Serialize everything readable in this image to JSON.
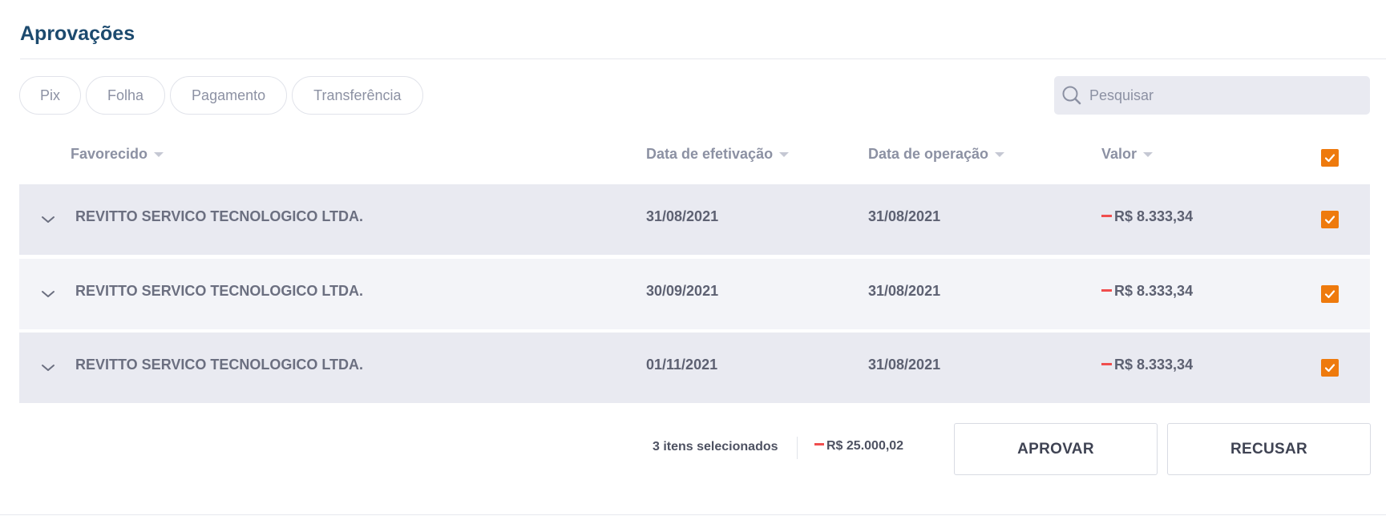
{
  "page": {
    "title": "Aprovações"
  },
  "filters": [
    "Pix",
    "Folha",
    "Pagamento",
    "Transferência"
  ],
  "search": {
    "placeholder": "Pesquisar",
    "value": ""
  },
  "table": {
    "columns": {
      "favorecido": "Favorecido",
      "data_efetivacao": "Data de efetivação",
      "data_operacao": "Data de operação",
      "valor": "Valor"
    },
    "select_all": true,
    "rows": [
      {
        "favorecido": "REVITTO SERVICO TECNOLOGICO LTDA.",
        "data_efetivacao": "31/08/2021",
        "data_operacao": "31/08/2021",
        "valor": "R$ 8.333,34",
        "negative": true,
        "checked": true
      },
      {
        "favorecido": "REVITTO SERVICO TECNOLOGICO LTDA.",
        "data_efetivacao": "30/09/2021",
        "data_operacao": "31/08/2021",
        "valor": "R$ 8.333,34",
        "negative": true,
        "checked": true
      },
      {
        "favorecido": "REVITTO SERVICO TECNOLOGICO LTDA.",
        "data_efetivacao": "01/11/2021",
        "data_operacao": "31/08/2021",
        "valor": "R$ 8.333,34",
        "negative": true,
        "checked": true
      }
    ]
  },
  "footer": {
    "selected_count": "3 itens selecionados",
    "total": "R$ 25.000,02",
    "approve_label": "APROVAR",
    "reject_label": "RECUSAR"
  },
  "colors": {
    "title": "#1c4a6e",
    "checkbox": "#ee7a0d",
    "negative": "#f04e4e",
    "row_dark": "#e9eaf1",
    "row_light": "#f3f4f8"
  },
  "icons": [
    "search-icon",
    "sort-caret-icon",
    "chevron-down-icon",
    "checkmark-icon",
    "minus-icon"
  ]
}
